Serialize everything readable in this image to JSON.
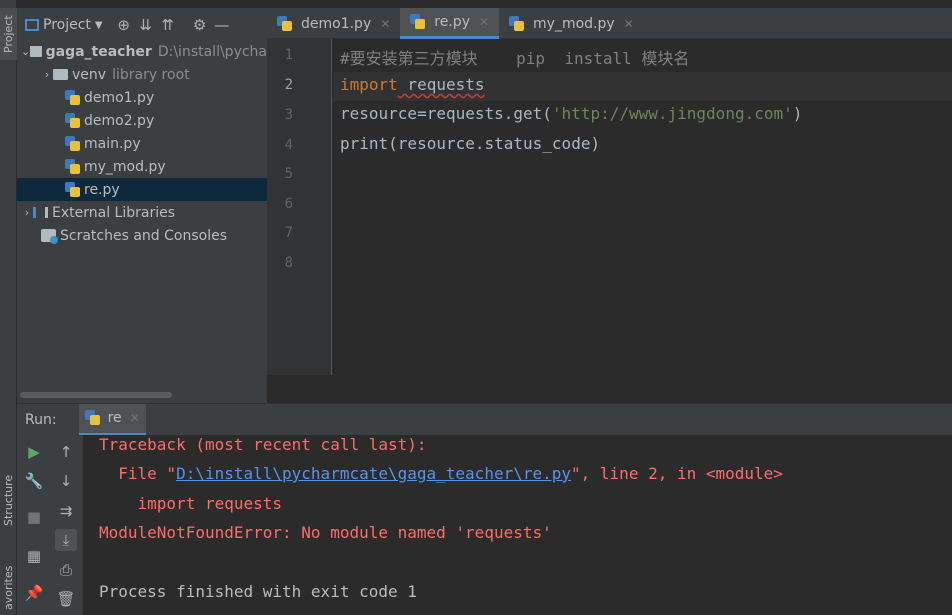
{
  "side_tabs": {
    "project": "Project",
    "structure": "Structure",
    "favorites": "avorites"
  },
  "project_toolbar": {
    "title": "Project",
    "dropdown_icon": "chevron-down-icon"
  },
  "tree": {
    "root_name": "gaga_teacher",
    "root_path": "D:\\install\\pycha",
    "venv": "venv",
    "venv_hint": "library root",
    "files": [
      "demo1.py",
      "demo2.py",
      "main.py",
      "my_mod.py",
      "re.py"
    ],
    "external_libs": "External Libraries",
    "scratches": "Scratches and Consoles"
  },
  "editor_tabs": [
    {
      "label": "demo1.py"
    },
    {
      "label": "re.py"
    },
    {
      "label": "my_mod.py"
    }
  ],
  "line_numbers": [
    "1",
    "2",
    "3",
    "4",
    "5",
    "6",
    "7",
    "8"
  ],
  "code": {
    "line1_comment": "#要安装第三方模块    pip  install 模块名",
    "line2_kw": "import",
    "line2_rest": " requests",
    "line3_a": "resource=requests.get(",
    "line3_str": "'http://www.jingdong.com'",
    "line3_b": ")",
    "line4": "print(resource.status_code)"
  },
  "run": {
    "label": "Run:",
    "tab": "re",
    "traceback": "Traceback (most recent call last):",
    "file_prefix": "  File \"",
    "file_link": "D:\\install\\pycharmcate\\gaga_teacher\\re.py",
    "file_suffix": "\", line 2, in <module>",
    "import_line": "    import requests",
    "error": "ModuleNotFoundError: No module named 'requests'",
    "finished": "Process finished with exit code 1"
  }
}
